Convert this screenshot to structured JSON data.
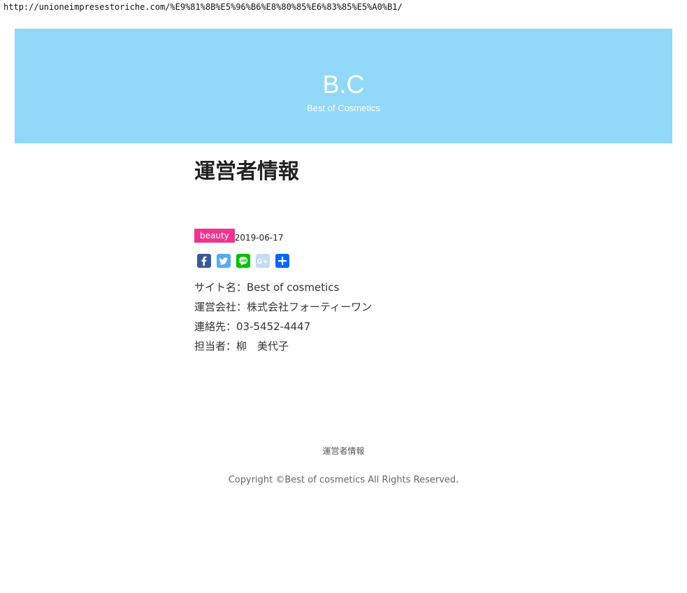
{
  "browser": {
    "url": "http://unioneimpresestoriche.com/%E9%81%8B%E5%96%B6%E8%80%85%E6%83%85%E5%A0%B1/"
  },
  "header": {
    "logo": "B.C",
    "tagline": "Best of Cosmetics",
    "bg_color": "#92d8f8"
  },
  "post": {
    "title": "運営者情報",
    "category": "beauty",
    "category_color": "#f0338f",
    "date": "2019-06-17",
    "share_icons": [
      "facebook-icon",
      "twitter-icon",
      "line-icon",
      "google-plus-icon",
      "share-plus-icon"
    ],
    "info_lines": [
      "サイト名：Best of cosmetics",
      "運営会社：株式会社フォーティーワン",
      "連絡先：03-5452-4447",
      "担当者：柳　美代子"
    ]
  },
  "footer": {
    "link": "運営者情報",
    "copyright": "Copyright ©Best of cosmetics All Rights Reserved."
  }
}
